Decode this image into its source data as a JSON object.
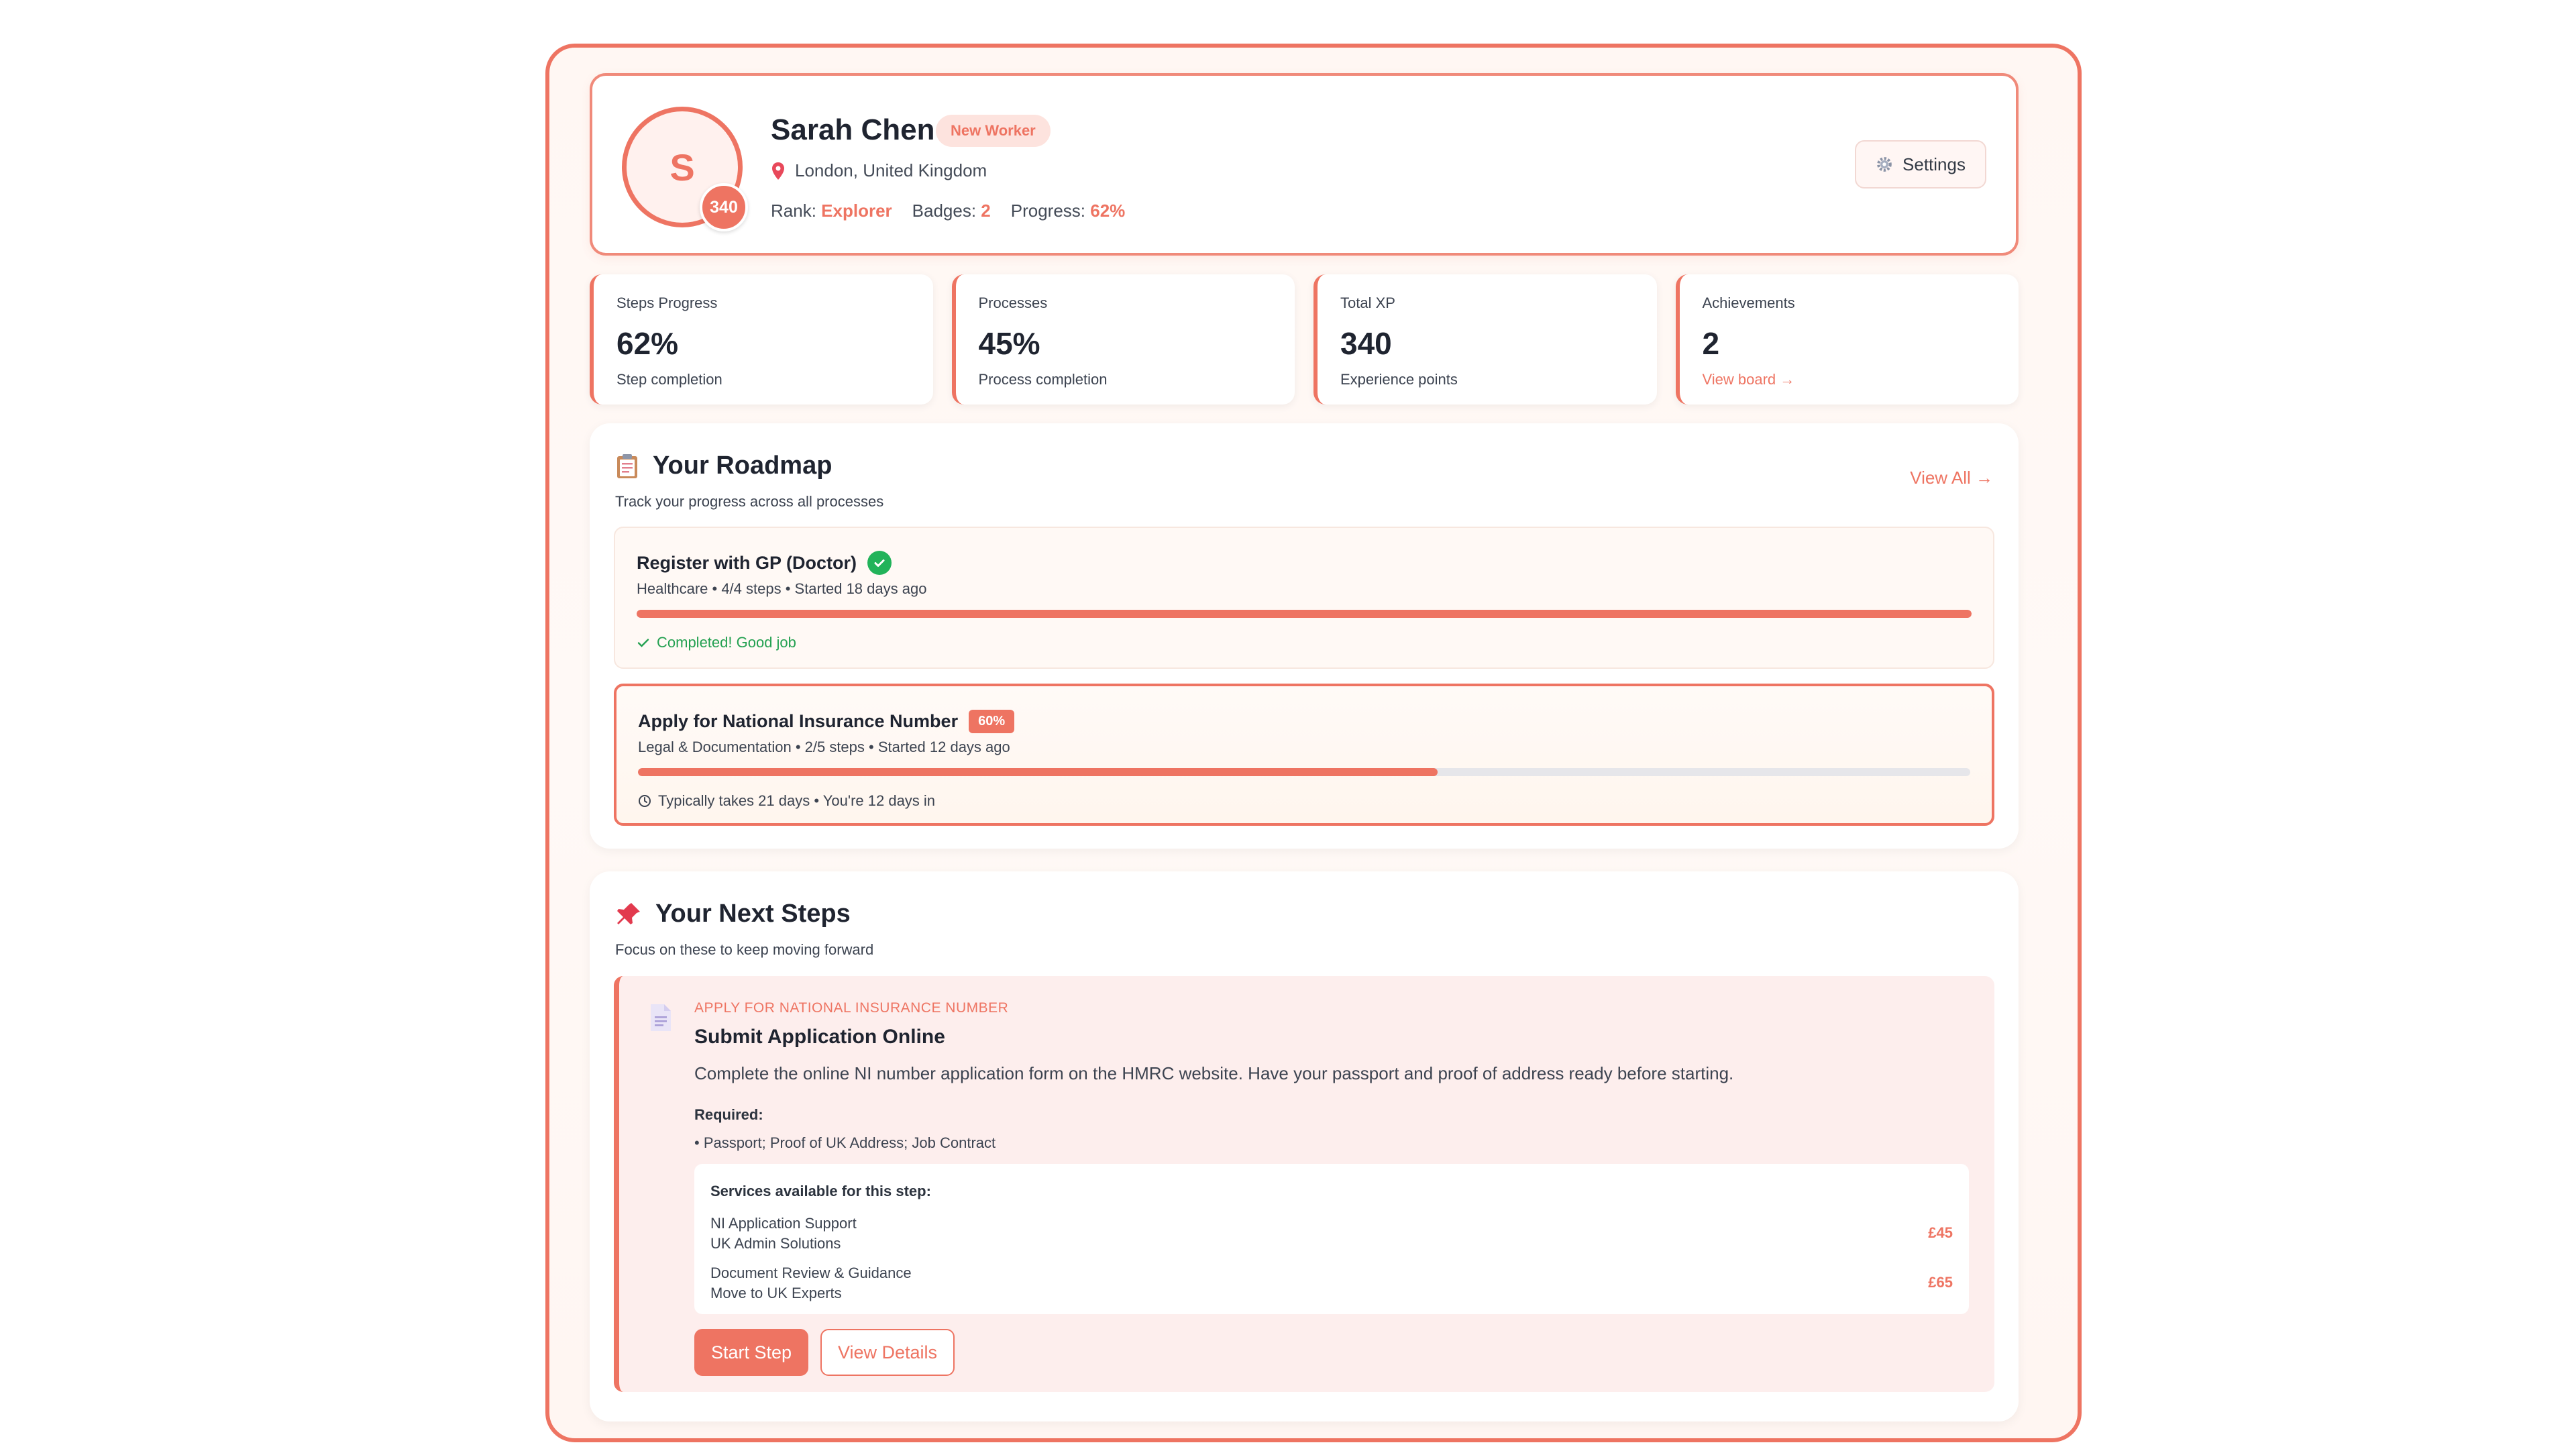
{
  "colors": {
    "accent": "#ee7462",
    "success": "#22b35a",
    "text": "#1f2430"
  },
  "profile": {
    "avatar_initial": "S",
    "xp_badge": "340",
    "name": "Sarah Chen",
    "tag": "New Worker",
    "location": "London, United Kingdom",
    "rank_label": "Rank:",
    "rank_value": "Explorer",
    "badges_label": "Badges:",
    "badges_value": "2",
    "progress_label": "Progress:",
    "progress_value": "62%",
    "settings_label": "Settings"
  },
  "stats": [
    {
      "label": "Steps Progress",
      "value": "62%",
      "sub": "Step completion"
    },
    {
      "label": "Processes",
      "value": "45%",
      "sub": "Process completion"
    },
    {
      "label": "Total XP",
      "value": "340",
      "sub": "Experience points"
    },
    {
      "label": "Achievements",
      "value": "2",
      "link": "View board →"
    }
  ],
  "roadmap": {
    "title": "Your Roadmap",
    "subtitle": "Track your progress across all processes",
    "view_all": "View All →",
    "processes": [
      {
        "title": "Register with GP (Doctor)",
        "meta": "Healthcare • 4/4 steps • Started 18 days ago",
        "progress": 1.0,
        "note": "Completed! Good job"
      },
      {
        "title": "Apply for National Insurance Number",
        "badge": "60%",
        "meta": "Legal & Documentation • 2/5 steps • Started 12 days ago",
        "progress": 0.6,
        "note": "Typically takes 21 days • You're 12 days in"
      }
    ]
  },
  "next_steps": {
    "title": "Your Next Steps",
    "subtitle": "Focus on these to keep moving forward",
    "step": {
      "eyebrow": "APPLY FOR NATIONAL INSURANCE NUMBER",
      "title": "Submit Application Online",
      "description": "Complete the online NI number application form on the HMRC website. Have your passport and proof of address ready before starting.",
      "required_label": "Required:",
      "required_item": "•   Passport; Proof of UK Address; Job Contract",
      "services_title": "Services available for this step:",
      "services": [
        {
          "name": "NI Application Support",
          "provider": "UK Admin Solutions",
          "price": "£45"
        },
        {
          "name": "Document Review & Guidance",
          "provider": "Move to UK Experts",
          "price": "£65"
        }
      ],
      "start_label": "Start Step",
      "details_label": "View Details"
    }
  }
}
